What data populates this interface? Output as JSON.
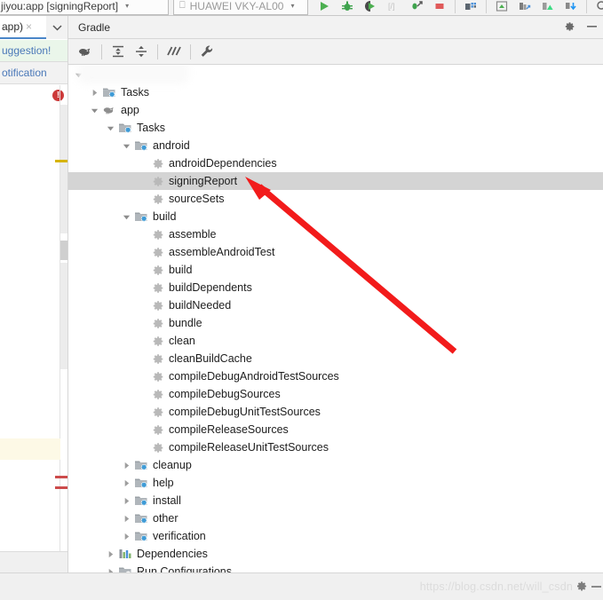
{
  "topbar": {
    "run_config": "jiyou:app [signingReport]",
    "run_config_caret": "▾",
    "device": "HUAWEI VKY-AL00",
    "device_caret": "▾",
    "device_icon": "device-icon",
    "icons": [
      {
        "name": "run-icon",
        "glyph": "▶",
        "color": "#4caf50"
      },
      {
        "name": "debug-icon",
        "glyph": "⚙",
        "color": "#3fa34d"
      },
      {
        "name": "run-coverage-icon",
        "glyph": "◖",
        "color": "#4caf50"
      },
      {
        "name": "profiler-icon",
        "glyph": "⎇",
        "color": "#bdbdbd"
      },
      {
        "name": "attach-debugger-icon",
        "glyph": "⤵",
        "color": "#3fa34d"
      },
      {
        "name": "stop-icon",
        "glyph": "■",
        "color": "#e05a5a"
      },
      {
        "name": "layout-inspector-icon",
        "glyph": "▣",
        "color": "#5c6670"
      },
      {
        "name": "avd-manager-icon",
        "glyph": "▢",
        "color": "#4caf50"
      },
      {
        "name": "sdk-manager-icon",
        "glyph": "▤",
        "color": "#4a90d9"
      },
      {
        "name": "android-icon",
        "glyph": "▲",
        "color": "#3ddc84"
      },
      {
        "name": "sync-gradle-icon",
        "glyph": "⇊",
        "color": "#4a90d9"
      },
      {
        "name": "search-icon",
        "glyph": "⚲",
        "color": "#6b6b6b"
      }
    ]
  },
  "editor": {
    "tab_label": "app)",
    "tab_close_icon": "close-icon",
    "tab_close_glyph": "×",
    "tab_chevron_glyph": "⌄",
    "notification_suggestion": "uggestion!",
    "notification_notification": "otification",
    "error_badge": "!",
    "markers": {
      "warning_stripe_color": "#d6b400",
      "error_stripe_color": "#cc4b4b",
      "caret_line_color": "#fdf9e6"
    }
  },
  "gradle": {
    "title": "Gradle",
    "header_actions": [
      {
        "name": "settings-gear-icon",
        "glyph": "⚙"
      },
      {
        "name": "minimize-icon",
        "glyph": "—"
      }
    ],
    "toolbar": [
      {
        "name": "execute-gradle-task-icon",
        "glyph": "elephant"
      },
      {
        "name": "expand-all-icon",
        "glyph": "expand"
      },
      {
        "name": "collapse-all-icon",
        "glyph": "collapse"
      },
      {
        "name": "toggle-offline-mode-icon",
        "glyph": "offline"
      },
      {
        "name": "gradle-settings-icon",
        "glyph": "wrench"
      }
    ],
    "tree": [
      {
        "indent": 0,
        "expander": "expanded",
        "icon": "project-icon",
        "label": "",
        "redacted": true
      },
      {
        "indent": 1,
        "expander": "collapsed",
        "icon": "tasks-folder-icon",
        "label": "Tasks"
      },
      {
        "indent": 1,
        "expander": "expanded",
        "icon": "gradle-module-icon",
        "label": "app"
      },
      {
        "indent": 2,
        "expander": "expanded",
        "icon": "tasks-folder-icon",
        "label": "Tasks"
      },
      {
        "indent": 3,
        "expander": "expanded",
        "icon": "tasks-folder-icon",
        "label": "android"
      },
      {
        "indent": 4,
        "expander": "none",
        "icon": "gradle-task-icon",
        "label": "androidDependencies"
      },
      {
        "indent": 4,
        "expander": "none",
        "icon": "gradle-task-icon",
        "label": "signingReport",
        "selected": true
      },
      {
        "indent": 4,
        "expander": "none",
        "icon": "gradle-task-icon",
        "label": "sourceSets"
      },
      {
        "indent": 3,
        "expander": "expanded",
        "icon": "tasks-folder-icon",
        "label": "build"
      },
      {
        "indent": 4,
        "expander": "none",
        "icon": "gradle-task-icon",
        "label": "assemble"
      },
      {
        "indent": 4,
        "expander": "none",
        "icon": "gradle-task-icon",
        "label": "assembleAndroidTest"
      },
      {
        "indent": 4,
        "expander": "none",
        "icon": "gradle-task-icon",
        "label": "build"
      },
      {
        "indent": 4,
        "expander": "none",
        "icon": "gradle-task-icon",
        "label": "buildDependents"
      },
      {
        "indent": 4,
        "expander": "none",
        "icon": "gradle-task-icon",
        "label": "buildNeeded"
      },
      {
        "indent": 4,
        "expander": "none",
        "icon": "gradle-task-icon",
        "label": "bundle"
      },
      {
        "indent": 4,
        "expander": "none",
        "icon": "gradle-task-icon",
        "label": "clean"
      },
      {
        "indent": 4,
        "expander": "none",
        "icon": "gradle-task-icon",
        "label": "cleanBuildCache"
      },
      {
        "indent": 4,
        "expander": "none",
        "icon": "gradle-task-icon",
        "label": "compileDebugAndroidTestSources"
      },
      {
        "indent": 4,
        "expander": "none",
        "icon": "gradle-task-icon",
        "label": "compileDebugSources"
      },
      {
        "indent": 4,
        "expander": "none",
        "icon": "gradle-task-icon",
        "label": "compileDebugUnitTestSources"
      },
      {
        "indent": 4,
        "expander": "none",
        "icon": "gradle-task-icon",
        "label": "compileReleaseSources"
      },
      {
        "indent": 4,
        "expander": "none",
        "icon": "gradle-task-icon",
        "label": "compileReleaseUnitTestSources"
      },
      {
        "indent": 3,
        "expander": "collapsed",
        "icon": "tasks-folder-icon",
        "label": "cleanup"
      },
      {
        "indent": 3,
        "expander": "collapsed",
        "icon": "tasks-folder-icon",
        "label": "help"
      },
      {
        "indent": 3,
        "expander": "collapsed",
        "icon": "tasks-folder-icon",
        "label": "install"
      },
      {
        "indent": 3,
        "expander": "collapsed",
        "icon": "tasks-folder-icon",
        "label": "other"
      },
      {
        "indent": 3,
        "expander": "collapsed",
        "icon": "tasks-folder-icon",
        "label": "verification"
      },
      {
        "indent": 2,
        "expander": "collapsed",
        "icon": "dependencies-icon",
        "label": "Dependencies"
      },
      {
        "indent": 2,
        "expander": "collapsed",
        "icon": "run-configurations-icon",
        "label": "Run Configurations"
      }
    ]
  },
  "statusbar": {
    "watermark": "https://blog.csdn.net/will_csdn",
    "gear_icon": "settings-gear-icon",
    "gear_glyph": "⚙"
  },
  "annotation": {
    "arrow_color": "#f21b1b",
    "arrow_name": "red-pointer-arrow"
  }
}
